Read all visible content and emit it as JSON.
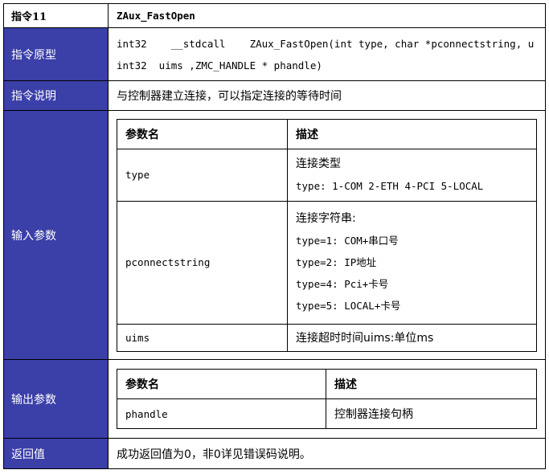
{
  "header": {
    "label": "指令11",
    "name": "ZAux_FastOpen"
  },
  "prototype": {
    "label": "指令原型",
    "line1": "int32    __stdcall    ZAux_FastOpen(int type, char *pconnectstring, u",
    "line2": "int32  uims ,ZMC_HANDLE * phandle)"
  },
  "description": {
    "label": "指令说明",
    "text": "与控制器建立连接，可以指定连接的等待时间"
  },
  "inputs": {
    "label": "输入参数",
    "col_name": "参数名",
    "col_desc": "描述",
    "rows": [
      {
        "name": "type",
        "desc": [
          "连接类型",
          "type: 1-COM 2-ETH 4-PCI 5-LOCAL"
        ]
      },
      {
        "name": "pconnectstring",
        "desc": [
          "连接字符串:",
          "type=1: COM+串口号",
          "type=2: IP地址",
          "type=4: Pci+卡号",
          "type=5: LOCAL+卡号"
        ]
      },
      {
        "name": "uims",
        "desc": [
          "连接超时时间uims:单位ms"
        ]
      }
    ]
  },
  "outputs": {
    "label": "输出参数",
    "col_name": "参数名",
    "col_desc": "描述",
    "rows": [
      {
        "name": "phandle",
        "desc": "控制器连接句柄"
      }
    ]
  },
  "returns": {
    "label": "返回值",
    "text": "成功返回值为0，非0详见错误码说明。"
  }
}
